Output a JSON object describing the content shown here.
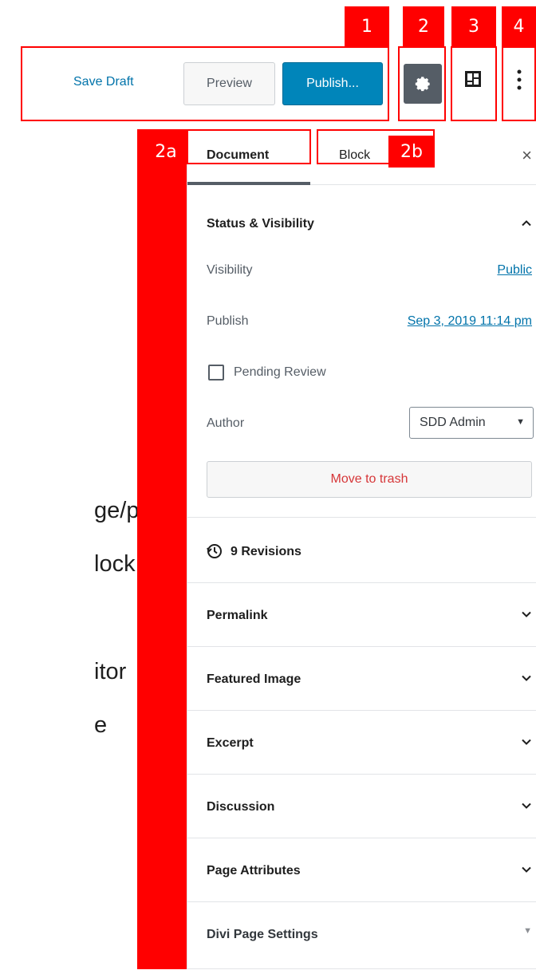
{
  "toolbar": {
    "save_draft": "Save Draft",
    "preview": "Preview",
    "publish": "Publish...",
    "settings_icon": "gear-icon",
    "blocks_icon": "block-navigation-icon",
    "more_icon": "more-vertical-icon"
  },
  "annotations": {
    "labels": [
      "1",
      "2",
      "3",
      "4",
      "2a",
      "2b"
    ],
    "color": "#ff0000"
  },
  "sidebar": {
    "tabs": [
      {
        "label": "Document"
      },
      {
        "label": "Block"
      }
    ],
    "close_label": "×",
    "status_visibility": {
      "title": "Status & Visibility",
      "visibility_label": "Visibility",
      "visibility_value": "Public",
      "publish_label": "Publish",
      "publish_value": "Sep 3, 2019 11:14 pm",
      "pending_review": "Pending Review",
      "author_label": "Author",
      "author_value": "SDD Admin",
      "trash": "Move to trash"
    },
    "revisions": "9 Revisions",
    "panels": [
      {
        "title": "Permalink"
      },
      {
        "title": "Featured Image"
      },
      {
        "title": "Excerpt"
      },
      {
        "title": "Discussion"
      },
      {
        "title": "Page Attributes"
      },
      {
        "title": "Divi Page Settings"
      }
    ]
  },
  "background_text": {
    "line1": "ge/post",
    "line2": "lock.",
    "line3": "itor",
    "line4": "e"
  },
  "colors": {
    "accent": "#0085ba",
    "link": "#0073aa",
    "annotation": "#ff0000",
    "danger": "#d63638"
  }
}
